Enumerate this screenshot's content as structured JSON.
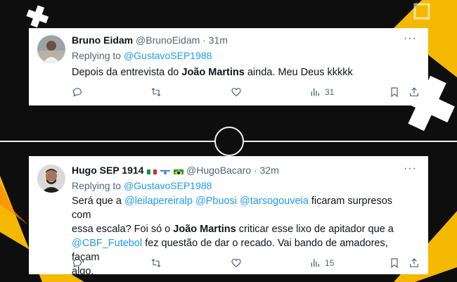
{
  "tweets": [
    {
      "name": "Bruno Eidam",
      "handle": "@BrunoEidam",
      "separator": "·",
      "time": "31m",
      "more": "···",
      "replying_prefix": "Replying to",
      "replying_to": "@GustavoSEP1988",
      "text_1": "Depois da entrevista do",
      "text_bold": "João Martins",
      "text_2": "ainda. Meu Deus kkkkk",
      "views": "31"
    },
    {
      "name": "Hugo SEP 1914",
      "flags": [
        "italy-flag-icon",
        "israel-flag-icon",
        "brazil-flag-icon"
      ],
      "handle": "@HugoBacaro",
      "separator": "·",
      "time": "32m",
      "more": "···",
      "replying_prefix": "Replying to",
      "replying_to": "@GustavoSEP1988",
      "text_line1_pre": "Será que a",
      "mention_1": "@leilapereiralp",
      "mention_2": "@Pbuosi",
      "mention_3": "@tarsogouveia",
      "text_line1_post": "ficaram surpresos com",
      "text_line2_pre": "essa escala? Foi só o",
      "text_bold": "João Martins",
      "text_line2_post": "criticar esse lixo de apitador que a",
      "mention_4": "@CBF_Futebol",
      "text_line3_post": "fez questão de dar o recado. Vai bando de amadores, façam",
      "text_line4": "algo.",
      "views": "15"
    }
  ],
  "colors": {
    "accent": "#1d9bf0",
    "secondary_text": "#536471",
    "background": "#0e0e0e",
    "stripe_yellow": "#f5b800"
  }
}
